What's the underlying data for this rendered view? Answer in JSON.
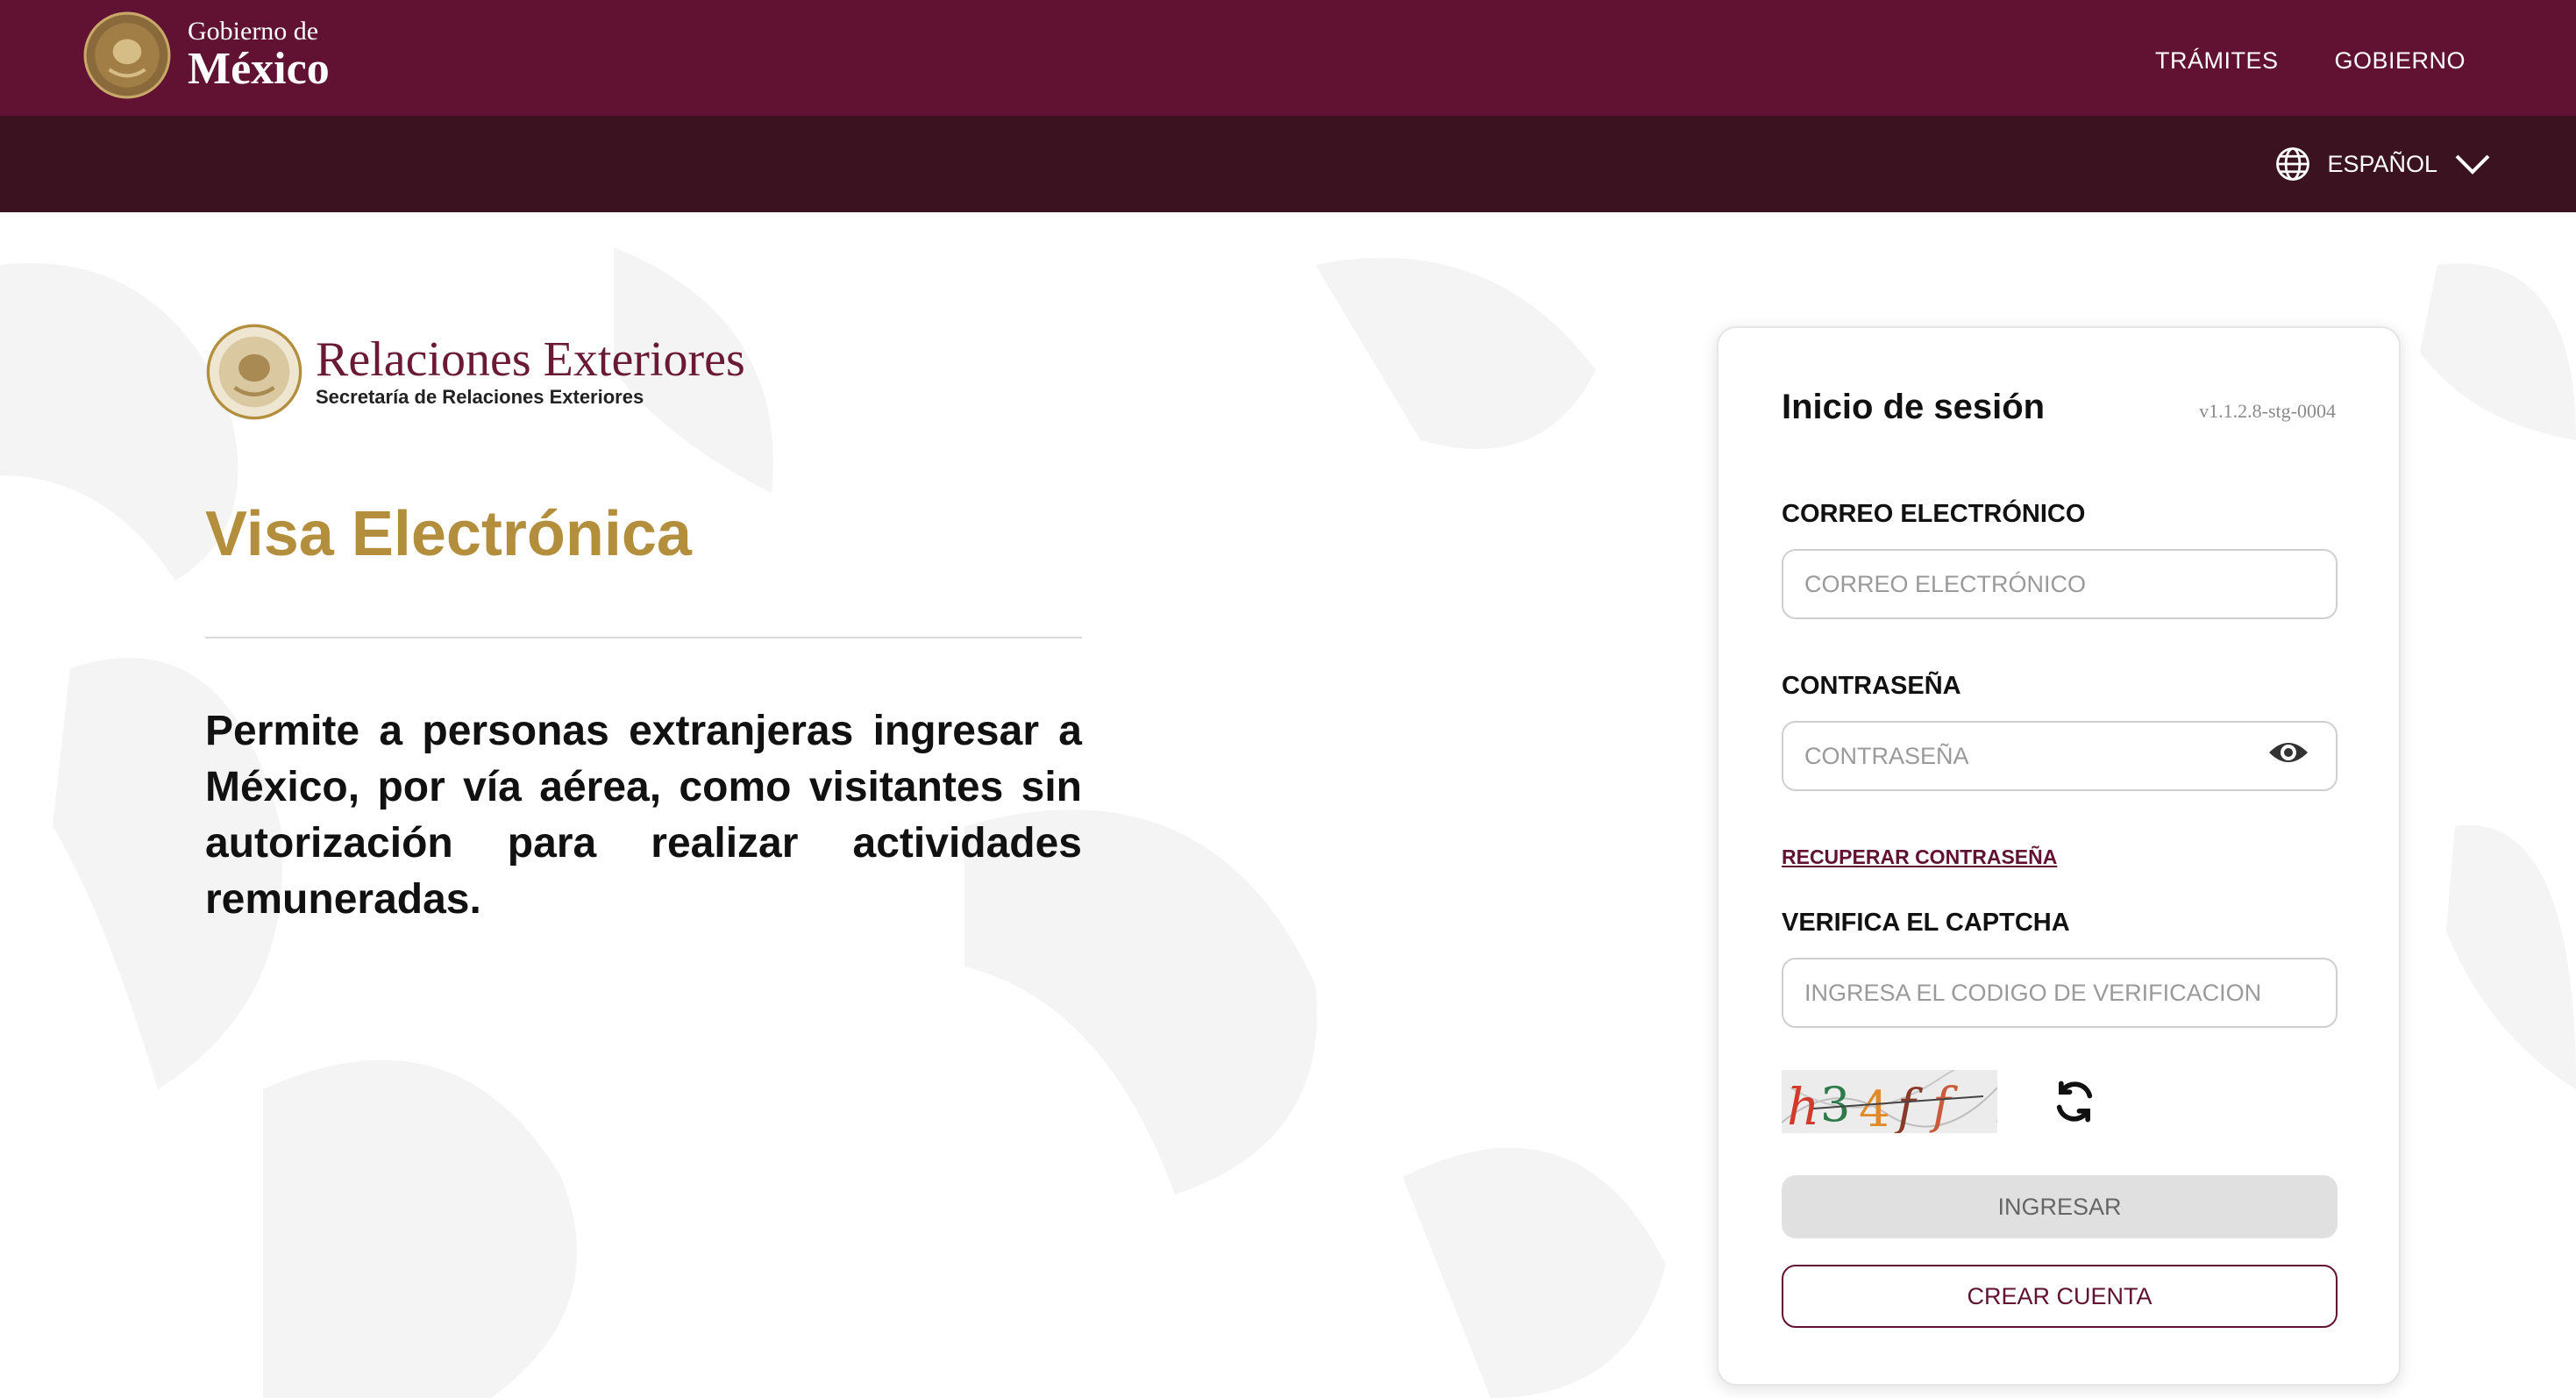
{
  "header": {
    "logo_line1": "Gobierno de",
    "logo_line2": "México",
    "nav": [
      "TRÁMITES",
      "GOBIERNO"
    ],
    "language": "ESPAÑOL",
    "brand_color": "#611232",
    "subbar_color": "#3b1220"
  },
  "sre": {
    "name": "Relaciones Exteriores",
    "subtitle": "Secretaría de Relaciones Exteriores"
  },
  "main": {
    "title": "Visa Electrónica",
    "title_color": "#b38e3c",
    "description": "Permite a personas extranjeras ingresar a México, por vía aérea, como visitantes sin autorización para realizar actividades remuneradas."
  },
  "login": {
    "title": "Inicio de sesión",
    "version": "v1.1.2.8-stg-0004",
    "email_label": "CORREO ELECTRÓNICO",
    "email_placeholder": "CORREO ELECTRÓNICO",
    "email_value": "",
    "password_label": "CONTRASEÑA",
    "password_placeholder": "CONTRASEÑA",
    "password_value": "",
    "recover_link": "RECUPERAR CONTRASEÑA",
    "captcha_label": "VERIFICA EL CAPTCHA",
    "captcha_placeholder": "INGRESA EL CODIGO DE VERIFICACION",
    "captcha_text": "h34ff",
    "submit_label": "INGRESAR",
    "create_label": "CREAR CUENTA"
  },
  "icons": [
    "seal-icon",
    "globe-icon",
    "chevron-down-icon",
    "eye-icon",
    "refresh-icon"
  ]
}
